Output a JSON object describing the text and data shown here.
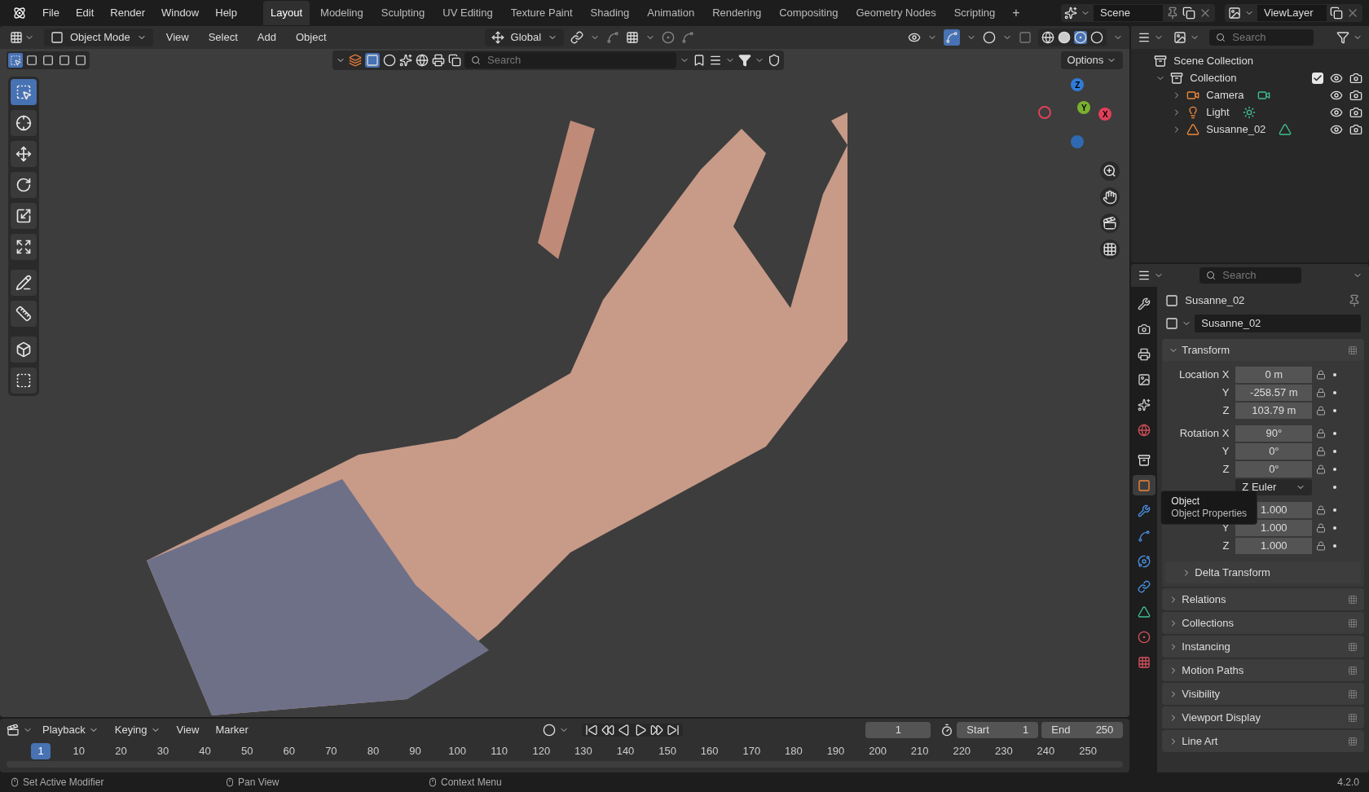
{
  "menu": [
    "File",
    "Edit",
    "Render",
    "Window",
    "Help"
  ],
  "workspaces": [
    {
      "label": "Layout",
      "selected": true
    },
    {
      "label": "Modeling",
      "selected": false
    },
    {
      "label": "Sculpting",
      "selected": false
    },
    {
      "label": "UV Editing",
      "selected": false
    },
    {
      "label": "Texture Paint",
      "selected": false
    },
    {
      "label": "Shading",
      "selected": false
    },
    {
      "label": "Animation",
      "selected": false
    },
    {
      "label": "Rendering",
      "selected": false
    },
    {
      "label": "Compositing",
      "selected": false
    },
    {
      "label": "Geometry Nodes",
      "selected": false
    },
    {
      "label": "Scripting",
      "selected": false
    }
  ],
  "add_workspace": "+",
  "scene": "Scene",
  "view_layer": "ViewLayer",
  "viewport_header": {
    "mode": "Object Mode",
    "menus": [
      "View",
      "Select",
      "Add",
      "Object"
    ],
    "orientation": "Global"
  },
  "tool_header": {
    "search_placeholder": "Search",
    "options": "Options"
  },
  "tools": [
    {
      "kind": "select",
      "selected": true
    },
    {
      "kind": "cursor",
      "selected": false
    },
    {
      "kind": "move",
      "selected": false
    },
    {
      "kind": "rotate",
      "selected": false
    },
    {
      "kind": "scale",
      "selected": false
    },
    {
      "kind": "transform",
      "selected": false
    },
    {
      "kind": "annotate",
      "selected": false
    },
    {
      "kind": "measure",
      "selected": false
    },
    {
      "kind": "add",
      "selected": false
    },
    {
      "kind": "extrude",
      "selected": false
    }
  ],
  "gizmo": {
    "x": "X",
    "y": "Y",
    "z": "Z"
  },
  "outliner": {
    "search_placeholder": "Search",
    "items": [
      {
        "name": "Scene Collection",
        "kind": "scene",
        "children": [
          {
            "name": "Collection",
            "kind": "collection",
            "expanded": true,
            "checked": true,
            "visible": true,
            "children": [
              {
                "name": "Camera",
                "kind": "camera",
                "expanded": false,
                "visible": true
              },
              {
                "name": "Light",
                "kind": "light",
                "expanded": false,
                "visible": true
              },
              {
                "name": "Susanne_02",
                "kind": "mesh",
                "expanded": false,
                "visible": true
              }
            ]
          }
        ]
      }
    ]
  },
  "properties": {
    "search_placeholder": "Search",
    "tabs": [
      {
        "kind": "tool",
        "selected": false
      },
      {
        "kind": "render",
        "selected": false
      },
      {
        "kind": "output",
        "selected": false
      },
      {
        "kind": "view_layer",
        "selected": false
      },
      {
        "kind": "scene",
        "selected": false
      },
      {
        "kind": "world",
        "selected": false
      },
      {
        "kind": "collection",
        "selected": false
      },
      {
        "kind": "object",
        "selected": true
      },
      {
        "kind": "modifiers",
        "selected": false
      },
      {
        "kind": "particles",
        "selected": false
      },
      {
        "kind": "physics",
        "selected": false
      },
      {
        "kind": "constraints",
        "selected": false
      },
      {
        "kind": "data",
        "selected": false
      },
      {
        "kind": "material",
        "selected": false
      },
      {
        "kind": "texture",
        "selected": false
      }
    ],
    "object_name": "Susanne_02",
    "data_name": "Susanne_02",
    "transform": {
      "title": "Transform",
      "expanded": true,
      "groups": [
        {
          "rows": [
            {
              "label": "Location X",
              "value": "0 m",
              "kind": "number"
            },
            {
              "label": "Y",
              "value": "-258.57 m",
              "kind": "number"
            },
            {
              "label": "Z",
              "value": "103.79 m",
              "kind": "number"
            }
          ]
        },
        {
          "rows": [
            {
              "label": "Rotation X",
              "value": "90°",
              "kind": "number"
            },
            {
              "label": "Y",
              "value": "0°",
              "kind": "number"
            },
            {
              "label": "Z",
              "value": "0°",
              "kind": "number"
            },
            {
              "value": "Z Euler",
              "kind": "dropdown"
            }
          ]
        },
        {
          "rows": [
            {
              "value": "1.000",
              "kind": "number"
            },
            {
              "label": "Y",
              "value": "1.000",
              "kind": "number"
            },
            {
              "label": "Z",
              "value": "1.000",
              "kind": "number"
            }
          ]
        }
      ],
      "subpanels": [
        {
          "title": "Delta Transform",
          "expanded": false
        }
      ]
    },
    "panels": [
      {
        "title": "Relations",
        "expanded": false
      },
      {
        "title": "Collections",
        "expanded": false
      },
      {
        "title": "Instancing",
        "expanded": false
      },
      {
        "title": "Motion Paths",
        "expanded": false
      },
      {
        "title": "Visibility",
        "expanded": false
      },
      {
        "title": "Viewport Display",
        "expanded": false
      },
      {
        "title": "Line Art",
        "expanded": false
      }
    ]
  },
  "tooltip": {
    "title": "Object",
    "subtitle": "Object Properties"
  },
  "timeline": {
    "menus": [
      "Playback",
      "Keying",
      "View",
      "Marker"
    ],
    "current_frame": "1",
    "start_label": "Start",
    "start": "1",
    "end_label": "End",
    "end": "250",
    "ticks": [
      {
        "label": "1",
        "selected": true
      },
      {
        "label": "10",
        "selected": false
      },
      {
        "label": "20",
        "selected": false
      },
      {
        "label": "30",
        "selected": false
      },
      {
        "label": "40",
        "selected": false
      },
      {
        "label": "50",
        "selected": false
      },
      {
        "label": "60",
        "selected": false
      },
      {
        "label": "70",
        "selected": false
      },
      {
        "label": "80",
        "selected": false
      },
      {
        "label": "90",
        "selected": false
      },
      {
        "label": "100",
        "selected": false
      },
      {
        "label": "110",
        "selected": false
      },
      {
        "label": "120",
        "selected": false
      },
      {
        "label": "130",
        "selected": false
      },
      {
        "label": "140",
        "selected": false
      },
      {
        "label": "150",
        "selected": false
      },
      {
        "label": "160",
        "selected": false
      },
      {
        "label": "170",
        "selected": false
      },
      {
        "label": "180",
        "selected": false
      },
      {
        "label": "190",
        "selected": false
      },
      {
        "label": "200",
        "selected": false
      },
      {
        "label": "210",
        "selected": false
      },
      {
        "label": "220",
        "selected": false
      },
      {
        "label": "230",
        "selected": false
      },
      {
        "label": "240",
        "selected": false
      },
      {
        "label": "250",
        "selected": false
      }
    ]
  },
  "status": {
    "hints": [
      "Set Active Modifier",
      "Pan View",
      "Context Menu"
    ],
    "version": "4.2.0"
  }
}
